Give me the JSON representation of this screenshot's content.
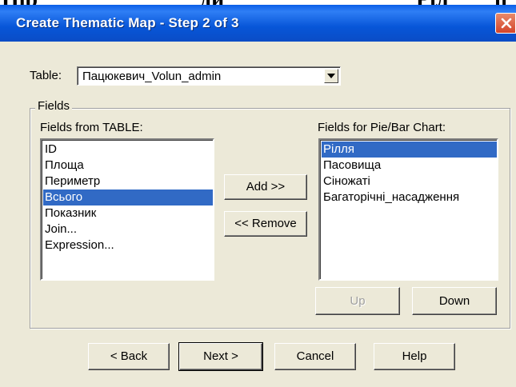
{
  "background_heading": [
    "Пір",
    "ди",
    "Ріл",
    "п"
  ],
  "window": {
    "title": "Create Thematic Map - Step 2 of 3"
  },
  "table": {
    "label": "Table:",
    "selected": "Пацюкевич_Volun_admin"
  },
  "fields_group": {
    "title": "Fields",
    "from_label": "Fields from TABLE:",
    "for_label": "Fields for Pie/Bar Chart:"
  },
  "fields_from": [
    "ID",
    "Площа",
    "Периметр",
    "Всього",
    "Показник",
    "Join...",
    "Expression..."
  ],
  "fields_from_selected": "Всього",
  "fields_for": [
    "Рілля",
    "Пасовища",
    "Сіножаті",
    "Багаторічні_насадження"
  ],
  "fields_for_selected": "Рілля",
  "buttons": {
    "add": "Add >>",
    "remove": "<< Remove",
    "up": "Up",
    "down": "Down",
    "back": "< Back",
    "next": "Next >",
    "cancel": "Cancel",
    "help": "Help"
  }
}
